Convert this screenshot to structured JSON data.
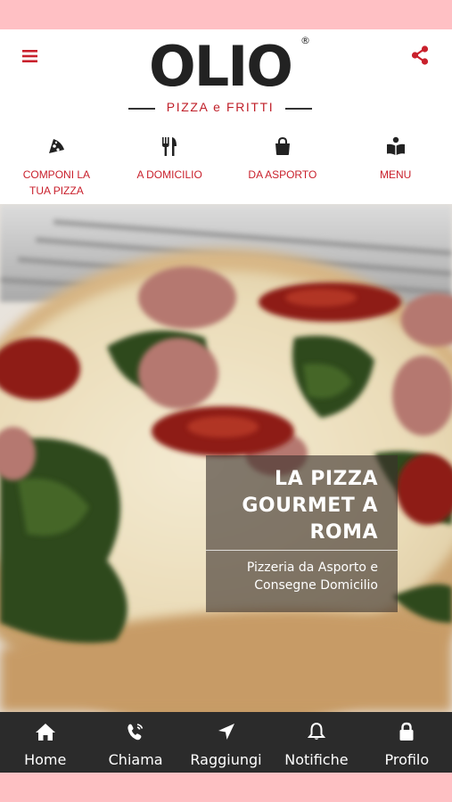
{
  "header": {
    "menu_icon": "hamburger-menu-icon",
    "share_icon": "share-icon",
    "logo": {
      "word": "OLIO",
      "registered": "®",
      "subtitle": "PIZZA e FRITTI"
    }
  },
  "quicknav": [
    {
      "label": "COMPONI LA TUA PIZZA",
      "icon": "pizza-slice-icon"
    },
    {
      "label": "A DOMICILIO",
      "icon": "fork-knife-icon"
    },
    {
      "label": "DA ASPORTO",
      "icon": "shopping-bag-icon"
    },
    {
      "label": "MENU",
      "icon": "menu-book-icon"
    }
  ],
  "hero": {
    "title": "LA PIZZA GOURMET A ROMA",
    "subtitle": "Pizzeria da Asporto e Consegne Domicilio"
  },
  "tabbar": [
    {
      "label": "Home",
      "icon": "home-icon"
    },
    {
      "label": "Chiama",
      "icon": "phone-icon"
    },
    {
      "label": "Raggiungi",
      "icon": "location-arrow-icon"
    },
    {
      "label": "Notifiche",
      "icon": "bell-icon"
    },
    {
      "label": "Profilo",
      "icon": "lock-icon"
    }
  ],
  "colors": {
    "accent": "#c9202c",
    "tabbar_bg": "#2b2b2b",
    "frame": "#ffc0c4"
  }
}
